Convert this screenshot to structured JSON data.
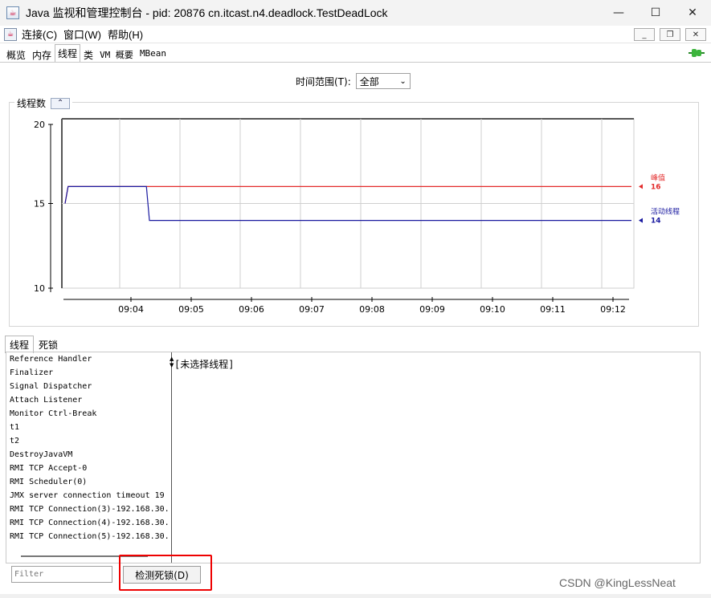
{
  "window": {
    "title": "Java 监视和管理控制台 - pid: 20876 cn.itcast.n4.deadlock.TestDeadLock",
    "min_icon": "minimize-icon",
    "max_icon": "maximize-icon",
    "close_icon": "close-icon"
  },
  "menu": {
    "items": [
      "连接(C)",
      "窗口(W)",
      "帮助(H)"
    ]
  },
  "tabs": [
    "概览",
    "内存",
    "线程",
    "类",
    "VM 概要",
    "MBean"
  ],
  "active_tab": "线程",
  "time_range": {
    "label": "时间范围(T):",
    "value": "全部"
  },
  "chart_data": {
    "type": "line",
    "title": "线程数",
    "x": [
      "09:04",
      "09:05",
      "09:06",
      "09:07",
      "09:08",
      "09:09",
      "09:10",
      "09:11",
      "09:12"
    ],
    "ylim": [
      10,
      20
    ],
    "yticks": [
      20,
      15,
      10
    ],
    "series": [
      {
        "name": "峰值",
        "value": 16,
        "color": "#e32b2b",
        "points": [
          [
            0,
            15
          ],
          [
            0.05,
            16
          ],
          [
            9.4,
            16
          ]
        ]
      },
      {
        "name": "活动线程",
        "value": 14,
        "color": "#1a1aa0",
        "points": [
          [
            0,
            15
          ],
          [
            0.05,
            16
          ],
          [
            1.35,
            16
          ],
          [
            1.4,
            14
          ],
          [
            9.4,
            14
          ]
        ]
      }
    ]
  },
  "thread_tabs": [
    "线程",
    "死锁"
  ],
  "threads": [
    "Reference Handler",
    "Finalizer",
    "Signal Dispatcher",
    "Attach Listener",
    "Monitor Ctrl-Break",
    "t1",
    "t2",
    "DestroyJavaVM",
    "RMI TCP Accept-0",
    "RMI Scheduler(0)",
    "JMX server connection timeout 19",
    "RMI TCP Connection(3)-192.168.30.",
    "RMI TCP Connection(4)-192.168.30.",
    "RMI TCP Connection(5)-192.168.30."
  ],
  "detail_text": "[未选择线程]",
  "filter_placeholder": "Filter",
  "detect_button": "检测死锁(D)",
  "watermark": "CSDN @KingLessNeat"
}
